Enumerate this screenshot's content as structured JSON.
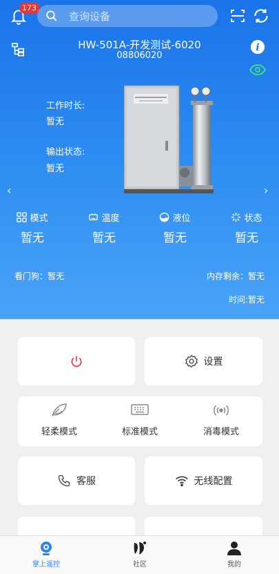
{
  "header": {
    "notification_count": "173",
    "search_placeholder": "查询设备",
    "icons": [
      "bell-icon",
      "search-icon",
      "scan-icon",
      "refresh-icon"
    ]
  },
  "device": {
    "name": "HW-501A-开发测试-6020",
    "id": "08806020",
    "work_duration_label": "工作时长:",
    "work_duration_value": "暂无",
    "output_status_label": "输出状态:",
    "output_status_value": "暂无"
  },
  "metrics": [
    {
      "label": "模式",
      "value": "暂无",
      "icon": "mode-grid-icon"
    },
    {
      "label": "温度",
      "value": "暂无",
      "icon": "temperature-icon"
    },
    {
      "label": "液位",
      "value": "暂无",
      "icon": "level-icon"
    },
    {
      "label": "状态",
      "value": "暂无",
      "icon": "status-icon"
    }
  ],
  "info": {
    "watchdog": "看门狗：暂无",
    "memory": "内存剩余：暂无",
    "time": "时间:暂无"
  },
  "controls": {
    "settings_label": "设置",
    "modes": [
      {
        "label": "轻柔模式",
        "icon": "feather-icon"
      },
      {
        "label": "标准模式",
        "icon": "keyboard-icon"
      },
      {
        "label": "消毒模式",
        "icon": "signal-icon"
      }
    ],
    "service_label": "客服",
    "wifi_label": "无线配置"
  },
  "tabbar": {
    "items": [
      {
        "label": "掌上遥控",
        "active": true
      },
      {
        "label": "社区",
        "active": false
      },
      {
        "label": "我的",
        "active": false
      }
    ]
  },
  "colors": {
    "accent": "#2a85f0",
    "power": "#e53935",
    "badge": "#e53935",
    "eye": "#3ddc84"
  }
}
